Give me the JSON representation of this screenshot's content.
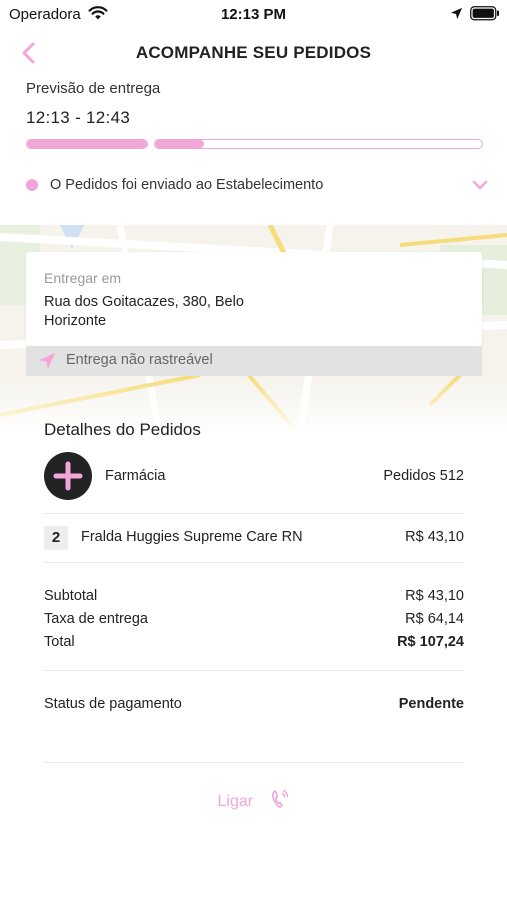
{
  "status_bar": {
    "carrier": "Operadora",
    "time": "12:13 PM",
    "icons": [
      "wifi-icon",
      "location-arrow-icon",
      "battery-icon"
    ]
  },
  "header": {
    "title": "ACOMPANHE SEU PEDIDOS",
    "back_icon": "chevron-left-icon"
  },
  "delivery": {
    "eta_label": "Previsão de entrega",
    "eta_window": "12:13 - 12:43",
    "progress_segments": [
      1.0,
      0.15
    ],
    "status_text": "O Pedidos foi enviado ao Estabelecimento",
    "expand_icon": "chevron-down-icon"
  },
  "address_card": {
    "label": "Entregar em",
    "address": "Rua dos Goitacazes, 380,  Belo Horizonte",
    "tracking_text": "Entrega não rastreável",
    "tracking_icon": "location-arrow-icon"
  },
  "details": {
    "title": "Detalhes do Pedidos",
    "store_name": "Farmácia",
    "order_number": "Pedidos 512",
    "store_icon": "plus-icon",
    "items": [
      {
        "qty": "2",
        "name": "Fralda Huggies Supreme Care RN",
        "price": "R$ 43,10"
      }
    ],
    "summary": {
      "subtotal_label": "Subtotal",
      "subtotal_value": "R$ 43,10",
      "delivery_fee_label": "Taxa de entrega",
      "delivery_fee_value": "R$ 64,14",
      "total_label": "Total",
      "total_value": "R$ 107,24"
    },
    "payment_status_label": "Status de pagamento",
    "payment_status_value": "Pendente"
  },
  "call": {
    "label": "Ligar",
    "icon": "phone-icon"
  },
  "colors": {
    "accent": "#f3a6d8",
    "dark": "#232323",
    "muted": "#999999",
    "track_bg": "#e2e2e2"
  }
}
